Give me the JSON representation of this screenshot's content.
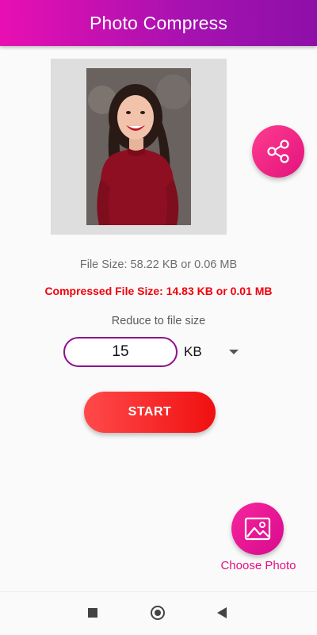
{
  "app_bar": {
    "title": "Photo Compress"
  },
  "photo": {
    "subject": "woman-portrait"
  },
  "info": {
    "file_size": "File Size: 58.22 KB or 0.06 MB",
    "compressed_size": "Compressed File Size: 14.83 KB or 0.01 MB",
    "reduce_label": "Reduce to file size"
  },
  "size_input": {
    "value": "15"
  },
  "unit_select": {
    "selected": "KB"
  },
  "start_button": {
    "label": "START"
  },
  "choose_photo": {
    "label": "Choose Photo"
  },
  "icons": {
    "share": "share-icon",
    "image": "image-icon",
    "nav_recents": "square-icon",
    "nav_home": "circle-icon",
    "nav_back": "triangle-back-icon"
  },
  "colors": {
    "app_bar_start": "#e80fb2",
    "app_bar_end": "#8e0fa8",
    "compressed_text": "#f0000a",
    "input_border": "#8d0f8e",
    "start_button": "#f01010",
    "accent_pink": "#e0127f"
  }
}
